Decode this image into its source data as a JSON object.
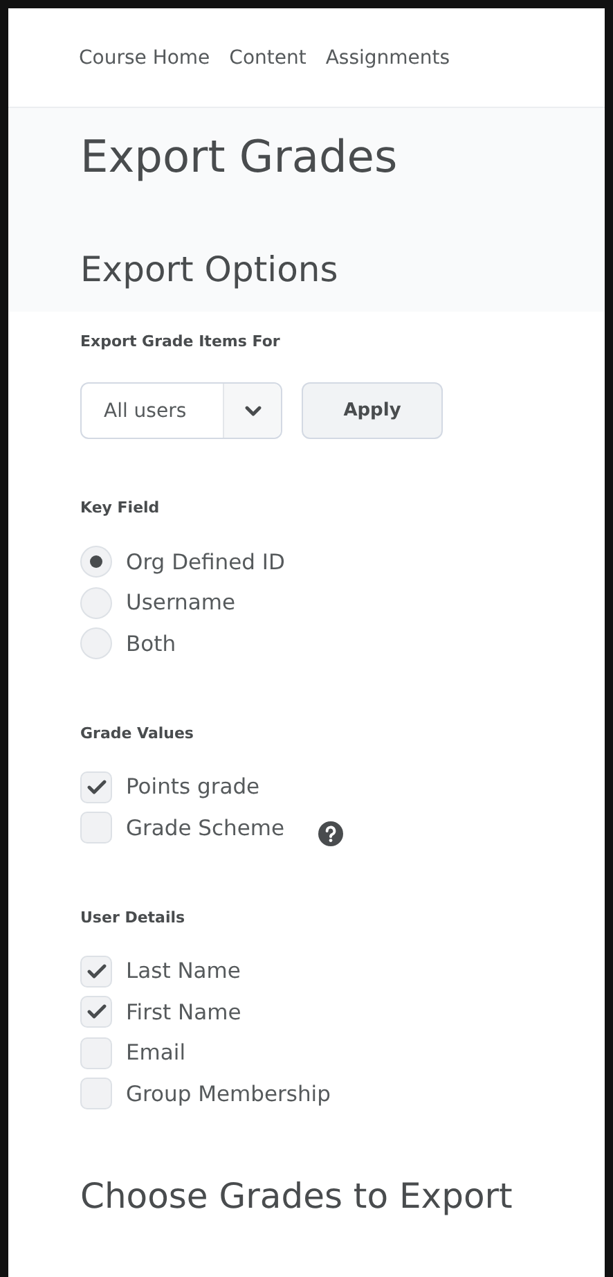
{
  "nav": [
    {
      "label": "Course Home"
    },
    {
      "label": "Content"
    },
    {
      "label": "Assignments"
    }
  ],
  "page_title": "Export Grades",
  "export_options": {
    "heading": "Export Options",
    "items_label": "Export Grade Items For",
    "select": {
      "value": "All users"
    },
    "apply_button": "Apply"
  },
  "groups": [
    {
      "label": "Key Field",
      "kind": "radio",
      "options": [
        {
          "label": "Org Defined ID",
          "selected": true
        },
        {
          "label": "Username",
          "selected": false
        },
        {
          "label": "Both",
          "selected": false
        }
      ]
    },
    {
      "label": "Grade Values",
      "kind": "checkbox",
      "options": [
        {
          "label": "Points grade",
          "checked": true,
          "help": false
        },
        {
          "label": "Grade Scheme",
          "checked": false,
          "help": true
        }
      ]
    },
    {
      "label": "User Details",
      "kind": "checkbox",
      "options": [
        {
          "label": "Last Name",
          "checked": true,
          "help": false
        },
        {
          "label": "First Name",
          "checked": true,
          "help": false
        },
        {
          "label": "Email",
          "checked": false,
          "help": false
        },
        {
          "label": "Group Membership",
          "checked": false,
          "help": false
        }
      ]
    }
  ],
  "next_heading": "Choose Grades to Export"
}
